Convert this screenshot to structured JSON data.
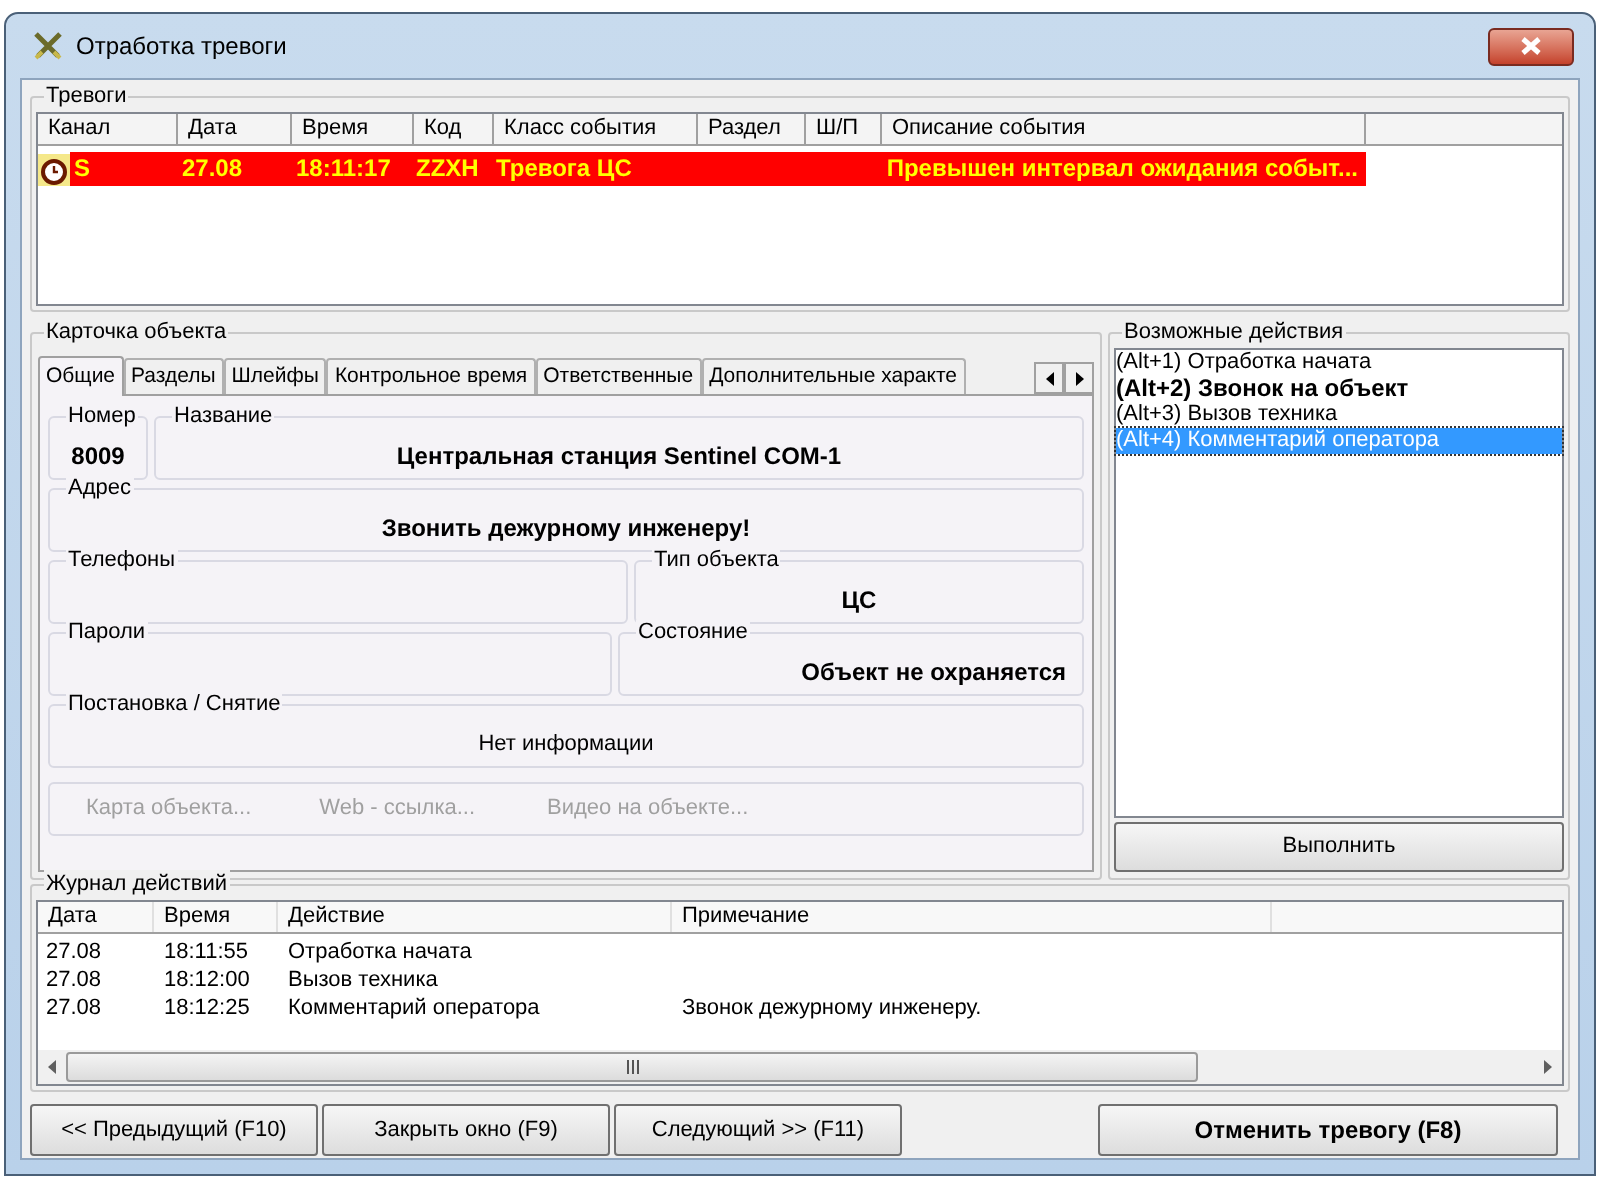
{
  "window": {
    "title": "Отработка тревоги"
  },
  "alarms": {
    "title": "Тревоги",
    "columns": [
      "Канал",
      "Дата",
      "Время",
      "Код",
      "Класс события",
      "Раздел",
      "Ш/П",
      "Описание события"
    ],
    "rows": [
      {
        "channel": "S",
        "date": "27.08",
        "time": "18:11:17",
        "code": "ZZXH",
        "event_class": "Тревога ЦС",
        "description": "Превышен интервал ожидания событ..."
      }
    ]
  },
  "object_card": {
    "title": "Карточка объекта",
    "tabs": [
      {
        "label": "Общие",
        "selected": true
      },
      {
        "label": "Разделы",
        "selected": false
      },
      {
        "label": "Шлейфы",
        "selected": false
      },
      {
        "label": "Контрольное время",
        "selected": false
      },
      {
        "label": "Ответственные",
        "selected": false
      },
      {
        "label": "Дополнительные характе",
        "selected": false
      }
    ],
    "number": {
      "label": "Номер",
      "value": "8009"
    },
    "name": {
      "label": "Название",
      "value": "Центральная станция Sentinel COM-1"
    },
    "address": {
      "label": "Адрес",
      "value": "Звонить дежурному инженеру!"
    },
    "phones": {
      "label": "Телефоны"
    },
    "object_type": {
      "label": "Тип объекта",
      "value": "ЦС"
    },
    "passwords": {
      "label": "Пароли"
    },
    "state": {
      "label": "Состояние",
      "value": "Объект не охраняется"
    },
    "arming": {
      "label": "Постановка / Снятие",
      "value": "Нет информации"
    },
    "links": [
      {
        "label": "Карта объекта...",
        "disabled": true
      },
      {
        "label": "Web - ссылка...",
        "disabled": true
      },
      {
        "label": "Видео на объекте...",
        "disabled": true
      }
    ]
  },
  "actions": {
    "title": "Возможные действия",
    "items": [
      {
        "label": "(Alt+1) Отработка начата",
        "bold": false,
        "selected": false
      },
      {
        "label": "(Alt+2) Звонок на объект",
        "bold": true,
        "selected": false
      },
      {
        "label": "(Alt+3) Вызов техника",
        "bold": false,
        "selected": false
      },
      {
        "label": "(Alt+4) Комментарий оператора",
        "bold": false,
        "selected": true
      }
    ],
    "execute_button": "Выполнить"
  },
  "journal": {
    "title": "Журнал действий",
    "columns": [
      "Дата",
      "Время",
      "Действие",
      "Примечание"
    ],
    "rows": [
      {
        "date": "27.08",
        "time": "18:11:55",
        "action": "Отработка начата"
      },
      {
        "date": "27.08",
        "time": "18:12:00",
        "action": "Вызов техника"
      },
      {
        "date": "27.08",
        "time": "18:12:25",
        "action": "Комментарий оператора",
        "note": "Звонок дежурному инженеру."
      }
    ]
  },
  "buttons": [
    {
      "label": "<< Предыдущий (F10)",
      "bold": false
    },
    {
      "label": "Закрыть окно (F9)",
      "bold": false
    },
    {
      "label": "Следующий >> (F11)",
      "bold": false
    },
    {
      "label": "Отменить тревогу (F8)",
      "bold": true
    }
  ]
}
